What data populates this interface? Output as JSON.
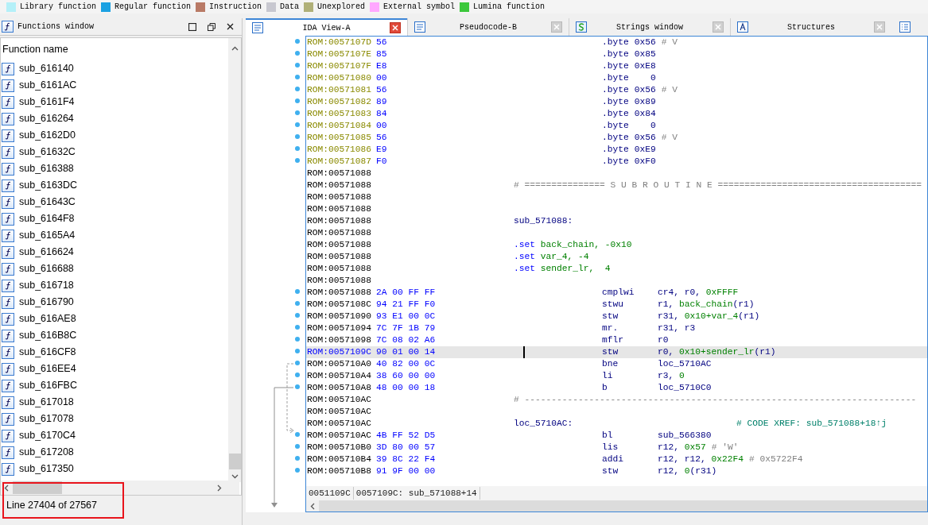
{
  "legend": [
    {
      "label": "Library function",
      "color": "#b4f0f8"
    },
    {
      "label": "Regular function",
      "color": "#1ba1e2"
    },
    {
      "label": "Instruction",
      "color": "#b97a66"
    },
    {
      "label": "Data",
      "color": "#c8c8d0"
    },
    {
      "label": "Unexplored",
      "color": "#b0b078"
    },
    {
      "label": "External symbol",
      "color": "#ffa8ff"
    },
    {
      "label": "Lumina function",
      "color": "#3cc83c"
    }
  ],
  "functions_window": {
    "title": "Functions window",
    "column": "Function name",
    "items": [
      {
        "name": "sub_616140"
      },
      {
        "name": "sub_6161AC"
      },
      {
        "name": "sub_6161F4"
      },
      {
        "name": "sub_616264"
      },
      {
        "name": "sub_6162D0"
      },
      {
        "name": "sub_61632C"
      },
      {
        "name": "sub_616388"
      },
      {
        "name": "sub_6163DC"
      },
      {
        "name": "sub_61643C"
      },
      {
        "name": "sub_6164F8"
      },
      {
        "name": "sub_6165A4"
      },
      {
        "name": "sub_616624"
      },
      {
        "name": "sub_616688"
      },
      {
        "name": "sub_616718"
      },
      {
        "name": "sub_616790"
      },
      {
        "name": "sub_616AE8"
      },
      {
        "name": "sub_616B8C"
      },
      {
        "name": "sub_616CF8"
      },
      {
        "name": "sub_616EE4"
      },
      {
        "name": "sub_616FBC"
      },
      {
        "name": "sub_617018"
      },
      {
        "name": "sub_617078"
      },
      {
        "name": "sub_6170C4"
      },
      {
        "name": "sub_617208"
      },
      {
        "name": "sub_617350"
      }
    ],
    "status": "Line 27404 of 27567"
  },
  "tabs": [
    {
      "label": "IDA View-A",
      "kind": "listing",
      "selected": true
    },
    {
      "label": "Pseudocode-B",
      "kind": "listing",
      "selected": false
    },
    {
      "label": "Strings window",
      "kind": "strings",
      "selected": false
    },
    {
      "label": "Structures",
      "kind": "struct",
      "selected": false
    }
  ],
  "lines": [
    {
      "address": "ROM:0057107D",
      "kind": "data",
      "bytes": "56",
      "dot": true,
      "selected": false,
      "mnemonic": ".byte",
      "operands": [
        {
          "text": "0x56",
          "kind": "reg"
        }
      ],
      "comment": "# V"
    },
    {
      "address": "ROM:0057107E",
      "kind": "data",
      "bytes": "85",
      "dot": true,
      "selected": false,
      "mnemonic": ".byte",
      "operands": [
        {
          "text": "0x85",
          "kind": "reg"
        }
      ]
    },
    {
      "address": "ROM:0057107F",
      "kind": "data",
      "bytes": "E8",
      "dot": true,
      "selected": false,
      "mnemonic": ".byte",
      "operands": [
        {
          "text": "0xE8",
          "kind": "reg"
        }
      ]
    },
    {
      "address": "ROM:00571080",
      "kind": "data",
      "bytes": "00",
      "dot": true,
      "selected": false,
      "mnemonic": ".byte",
      "operands": [
        {
          "text": "0",
          "kind": "reg"
        }
      ]
    },
    {
      "address": "ROM:00571081",
      "kind": "data",
      "bytes": "56",
      "dot": true,
      "selected": false,
      "mnemonic": ".byte",
      "operands": [
        {
          "text": "0x56",
          "kind": "reg"
        }
      ],
      "comment": "# V"
    },
    {
      "address": "ROM:00571082",
      "kind": "data",
      "bytes": "89",
      "dot": true,
      "selected": false,
      "mnemonic": ".byte",
      "operands": [
        {
          "text": "0x89",
          "kind": "reg"
        }
      ]
    },
    {
      "address": "ROM:00571083",
      "kind": "data",
      "bytes": "84",
      "dot": true,
      "selected": false,
      "mnemonic": ".byte",
      "operands": [
        {
          "text": "0x84",
          "kind": "reg"
        }
      ]
    },
    {
      "address": "ROM:00571084",
      "kind": "data",
      "bytes": "00",
      "dot": true,
      "selected": false,
      "mnemonic": ".byte",
      "operands": [
        {
          "text": "0",
          "kind": "reg"
        }
      ]
    },
    {
      "address": "ROM:00571085",
      "kind": "data",
      "bytes": "56",
      "dot": true,
      "selected": false,
      "mnemonic": ".byte",
      "operands": [
        {
          "text": "0x56",
          "kind": "reg"
        }
      ],
      "comment": "# V"
    },
    {
      "address": "ROM:00571086",
      "kind": "data",
      "bytes": "E9",
      "dot": true,
      "selected": false,
      "mnemonic": ".byte",
      "operands": [
        {
          "text": "0xE9",
          "kind": "reg"
        }
      ]
    },
    {
      "address": "ROM:00571087",
      "kind": "data",
      "bytes": "F0",
      "dot": true,
      "selected": false,
      "mnemonic": ".byte",
      "operands": [
        {
          "text": "0xF0",
          "kind": "reg"
        }
      ]
    },
    {
      "address": "ROM:00571088",
      "kind": "code",
      "dot": false,
      "selected": false
    },
    {
      "address": "ROM:00571088",
      "kind": "code",
      "dot": false,
      "selected": false,
      "label": [
        {
          "text": "# =============== S U B R O U T I N E ======================================",
          "kind": "sep"
        }
      ]
    },
    {
      "address": "ROM:00571088",
      "kind": "code",
      "dot": false,
      "selected": false
    },
    {
      "address": "ROM:00571088",
      "kind": "code",
      "dot": false,
      "selected": false
    },
    {
      "address": "ROM:00571088",
      "kind": "code",
      "dot": false,
      "selected": false,
      "label": [
        {
          "text": "sub_571088:",
          "kind": "reg"
        }
      ]
    },
    {
      "address": "ROM:00571088",
      "kind": "code",
      "dot": false,
      "selected": false
    },
    {
      "address": "ROM:00571088",
      "kind": "code",
      "dot": false,
      "selected": false,
      "label": [
        {
          "text": ".set",
          "kind": "directive"
        },
        {
          "text": " back_chain, -0x10",
          "kind": "num"
        }
      ]
    },
    {
      "address": "ROM:00571088",
      "kind": "code",
      "dot": false,
      "selected": false,
      "label": [
        {
          "text": ".set",
          "kind": "directive"
        },
        {
          "text": " var_4, -4",
          "kind": "num"
        }
      ]
    },
    {
      "address": "ROM:00571088",
      "kind": "code",
      "dot": false,
      "selected": false,
      "label": [
        {
          "text": ".set",
          "kind": "directive"
        },
        {
          "text": " sender_lr,  4",
          "kind": "num"
        }
      ]
    },
    {
      "address": "ROM:00571088",
      "kind": "code",
      "dot": false,
      "selected": false
    },
    {
      "address": "ROM:00571088",
      "kind": "code",
      "bytes": "2A 00 FF FF",
      "dot": true,
      "selected": false,
      "mnemonic": "cmplwi",
      "operands": [
        {
          "text": "cr4, r0, ",
          "kind": "reg"
        },
        {
          "text": "0xFFFF",
          "kind": "num"
        }
      ]
    },
    {
      "address": "ROM:0057108C",
      "kind": "code",
      "bytes": "94 21 FF F0",
      "dot": true,
      "selected": false,
      "mnemonic": "stwu",
      "operands": [
        {
          "text": "r1, ",
          "kind": "reg"
        },
        {
          "text": "back_chain",
          "kind": "num"
        },
        {
          "text": "(r1)",
          "kind": "reg"
        }
      ]
    },
    {
      "address": "ROM:00571090",
      "kind": "code",
      "bytes": "93 E1 00 0C",
      "dot": true,
      "selected": false,
      "mnemonic": "stw",
      "operands": [
        {
          "text": "r31, ",
          "kind": "reg"
        },
        {
          "text": "0x10+var_4",
          "kind": "num"
        },
        {
          "text": "(r1)",
          "kind": "reg"
        }
      ]
    },
    {
      "address": "ROM:00571094",
      "kind": "code",
      "bytes": "7C 7F 1B 79",
      "dot": true,
      "selected": false,
      "mnemonic": "mr.",
      "operands": [
        {
          "text": "r31, r3",
          "kind": "reg"
        }
      ]
    },
    {
      "address": "ROM:00571098",
      "kind": "code",
      "bytes": "7C 08 02 A6",
      "dot": true,
      "selected": false,
      "mnemonic": "mflr",
      "operands": [
        {
          "text": "r0",
          "kind": "reg"
        }
      ]
    },
    {
      "address": "ROM:0057109C",
      "kind": "code",
      "bytes": "90 01 00 14",
      "dot": true,
      "selected": true,
      "mnemonic": "stw",
      "operands": [
        {
          "text": "r0, ",
          "kind": "reg"
        },
        {
          "text": "0x10+sender_lr",
          "kind": "num"
        },
        {
          "text": "(r1)",
          "kind": "reg"
        }
      ]
    },
    {
      "address": "ROM:005710A0",
      "kind": "code",
      "bytes": "40 82 00 0C",
      "dot": true,
      "selected": false,
      "mnemonic": "bne",
      "operands": [
        {
          "text": "loc_5710AC",
          "kind": "reg"
        }
      ]
    },
    {
      "address": "ROM:005710A4",
      "kind": "code",
      "bytes": "38 60 00 00",
      "dot": true,
      "selected": false,
      "mnemonic": "li",
      "operands": [
        {
          "text": "r3, ",
          "kind": "reg"
        },
        {
          "text": "0",
          "kind": "num"
        }
      ]
    },
    {
      "address": "ROM:005710A8",
      "kind": "code",
      "bytes": "48 00 00 18",
      "dot": true,
      "selected": false,
      "mnemonic": "b",
      "operands": [
        {
          "text": "loc_5710C0",
          "kind": "reg"
        }
      ]
    },
    {
      "address": "ROM:005710AC",
      "kind": "code",
      "dot": false,
      "selected": false,
      "label": [
        {
          "text": "# -------------------------------------------------------------------------",
          "kind": "sep"
        }
      ]
    },
    {
      "address": "ROM:005710AC",
      "kind": "code",
      "dot": false,
      "selected": false
    },
    {
      "address": "ROM:005710AC",
      "kind": "code",
      "dot": false,
      "selected": false,
      "label": [
        {
          "text": "loc_5710AC:",
          "kind": "reg"
        }
      ],
      "xref": "# CODE XREF: sub_571088+18↑j"
    },
    {
      "address": "ROM:005710AC",
      "kind": "code",
      "bytes": "4B FF 52 D5",
      "dot": true,
      "selected": false,
      "mnemonic": "bl",
      "operands": [
        {
          "text": "sub_566380",
          "kind": "reg"
        }
      ]
    },
    {
      "address": "ROM:005710B0",
      "kind": "code",
      "bytes": "3D 80 00 57",
      "dot": true,
      "selected": false,
      "mnemonic": "lis",
      "operands": [
        {
          "text": "r12, ",
          "kind": "reg"
        },
        {
          "text": "0x57",
          "kind": "num"
        }
      ],
      "comment": "# 'W'"
    },
    {
      "address": "ROM:005710B4",
      "kind": "code",
      "bytes": "39 8C 22 F4",
      "dot": true,
      "selected": false,
      "mnemonic": "addi",
      "operands": [
        {
          "text": "r12, r12, ",
          "kind": "reg"
        },
        {
          "text": "0x22F4",
          "kind": "num"
        }
      ],
      "comment": "# 0x5722F4"
    },
    {
      "address": "ROM:005710B8",
      "kind": "code",
      "bytes": "91 9F 00 00",
      "dot": true,
      "selected": false,
      "mnemonic": "stw",
      "operands": [
        {
          "text": "r12, ",
          "kind": "reg"
        },
        {
          "text": "0",
          "kind": "num"
        },
        {
          "text": "(r31)",
          "kind": "reg"
        }
      ]
    }
  ],
  "code_status": [
    "0051109C",
    "0057109C: sub_571088+14"
  ]
}
